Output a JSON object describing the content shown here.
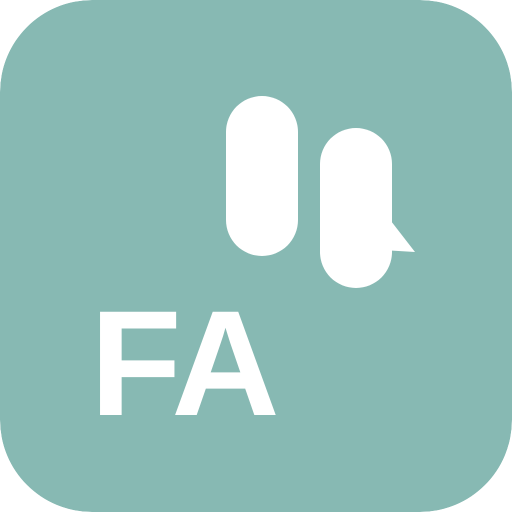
{
  "app_icon": {
    "label": "FA",
    "icon": "chat-bubbles-icon",
    "colors": {
      "background": "#87b9b3",
      "foreground": "#ffffff"
    }
  }
}
